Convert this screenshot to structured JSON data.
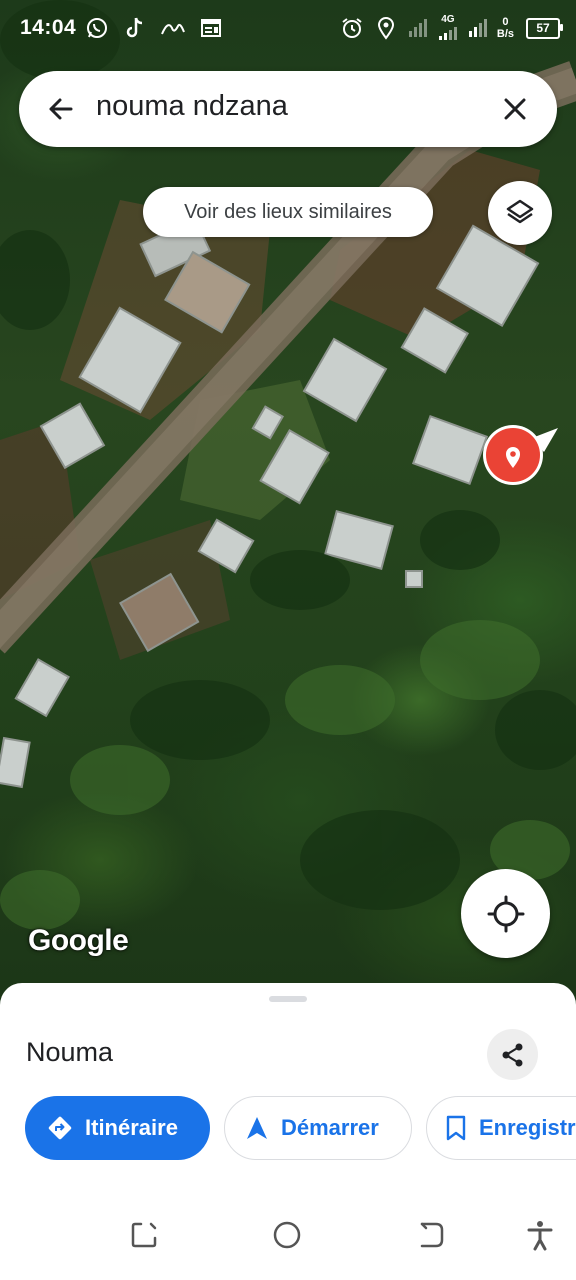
{
  "status_bar": {
    "time": "14:04",
    "network_type": "4G",
    "net_speed_value": "0",
    "net_speed_unit": "B/s",
    "battery_level": "57",
    "left_icons": [
      "whatsapp-icon",
      "tiktok-icon",
      "signature-icon",
      "news-icon"
    ],
    "right_icons": [
      "alarm-icon",
      "location-icon",
      "signal-icon",
      "signal-icon"
    ]
  },
  "search": {
    "query": "nouma ndzana"
  },
  "map": {
    "similar_places_chip": "Voir des lieux similaires",
    "attribution": "Google",
    "pin_color": "#ea4335"
  },
  "place": {
    "title": "Nouma"
  },
  "actions": {
    "directions": "Itinéraire",
    "start": "Démarrer",
    "save": "Enregistrer"
  },
  "colors": {
    "accent": "#1a73e8",
    "pin": "#ea4335"
  }
}
